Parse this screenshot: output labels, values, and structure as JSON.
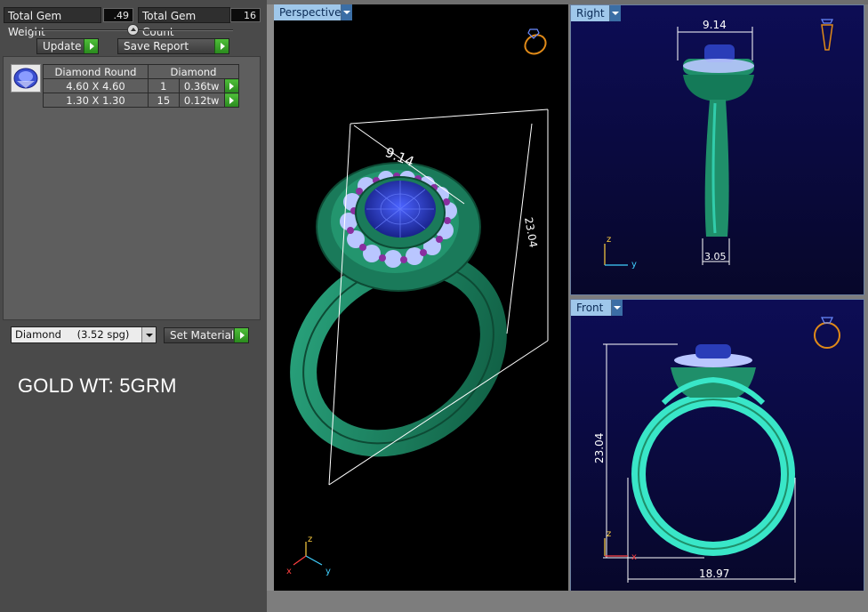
{
  "stats": {
    "total_gem_weight_label": "Total Gem Weight",
    "total_gem_weight_value": ".49",
    "total_gem_count_label": "Total Gem Count",
    "total_gem_count_value": "16"
  },
  "actions": {
    "update_label": "Update",
    "save_report_label": "Save Report",
    "set_material_label": "Set Material"
  },
  "gem_table": {
    "header": [
      "Diamond Round",
      "Diamond"
    ],
    "rows": [
      {
        "size": "4.60 X 4.60",
        "count": "1",
        "weight": "0.36tw"
      },
      {
        "size": "1.30 X 1.30",
        "count": "15",
        "weight": "0.12tw"
      }
    ]
  },
  "material": {
    "selected": "Diamond",
    "spg": "(3.52 spg)"
  },
  "note": "GOLD WT: 5GRM",
  "viewports": {
    "perspective": {
      "label": "Perspective",
      "dim_top": "9.14",
      "dim_side": "23.04"
    },
    "right": {
      "label": "Right",
      "dim_top": "9.14",
      "dim_bottom": "3.05",
      "axis_z": "z",
      "axis_y": "y"
    },
    "front": {
      "label": "Front",
      "dim_height": "23.04",
      "dim_width": "18.97",
      "axis_z": "z",
      "axis_x": "x"
    },
    "perspective_axes": {
      "z": "z",
      "x": "x",
      "y": "y"
    }
  },
  "colors": {
    "ring_metal": "#1f8f6a",
    "ring_highlight": "#39e6c8",
    "center_stone": "#2a3db8",
    "halo_stone": "#b9c6ff",
    "accent_bead": "#8a2fa0",
    "viewport_tab": "#9fc7ea",
    "go_button": "#3aaa2a"
  }
}
